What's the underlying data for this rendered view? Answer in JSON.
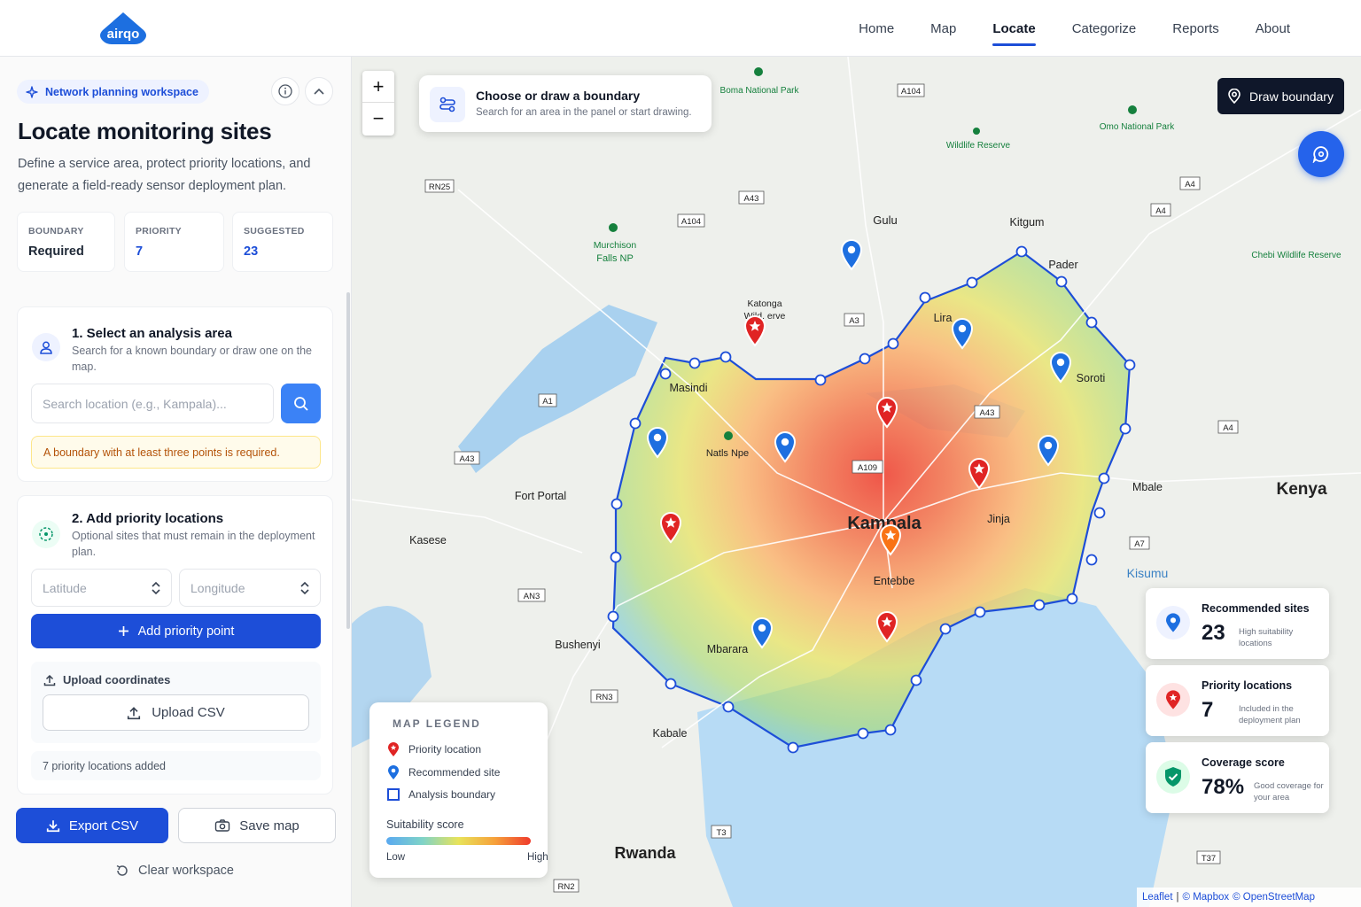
{
  "nav": {
    "brand": "airqo",
    "items": [
      "Home",
      "Map",
      "Locate",
      "Categorize",
      "Reports",
      "About"
    ],
    "active": "Locate"
  },
  "sidebar": {
    "badge": "Network planning workspace",
    "title": "Locate monitoring sites",
    "description": "Define a service area, protect priority locations, and generate a field-ready sensor deployment plan.",
    "stats": [
      {
        "label": "BOUNDARY",
        "value": "Required"
      },
      {
        "label": "PRIORITY",
        "value": "7"
      },
      {
        "label": "SUGGESTED",
        "value": "23"
      }
    ],
    "step1": {
      "title": "1. Select an analysis area",
      "subtitle": "Search for a known boundary or draw one on the map.",
      "search_placeholder": "Search location (e.g., Kampala)...",
      "warning": "A boundary with at least three points is required."
    },
    "step2": {
      "title": "2. Add priority locations",
      "subtitle": "Optional sites that must remain in the deployment plan.",
      "lat_placeholder": "Latitude",
      "lon_placeholder": "Longitude",
      "add_button": "Add priority point",
      "upload_title": "Upload coordinates",
      "upload_button": "Upload CSV",
      "added_text": "7 priority locations added"
    },
    "export_button": "Export CSV",
    "save_button": "Save map",
    "clear_button": "Clear workspace"
  },
  "map": {
    "boundary_card": {
      "title": "Choose or draw a boundary",
      "subtitle": "Search for an area in the panel or start drawing."
    },
    "draw_button": "Draw boundary",
    "labels": {
      "kampala": "Kampala",
      "entebbe": "Entebbe",
      "jinja": "Jinja",
      "masindi": "Masindi",
      "fort_portal": "Fort Portal",
      "kasese": "Kasese",
      "bushenyi": "Bushenyi",
      "mbarara": "Mbarara",
      "kabale": "Kabale",
      "rwanda": "Rwanda",
      "kenya": "Kenya",
      "kisumu": "Kisumu",
      "mbale": "Mbale",
      "soroti": "Soroti",
      "lira": "Lira",
      "gulu": "Gulu",
      "kitgum": "Kitgum",
      "pader": "Pader",
      "katonga": "Katonga",
      "wildlife_reserve_a": "Wild. erve",
      "murchison": "Murchison",
      "falls_np": "Falls NP",
      "boma": "Boma National Park",
      "omo": "Omo National Park",
      "wildlife_reserve": "Wildlife Reserve",
      "chebi": "Chebi Wildlife Reserve",
      "natls": "Natls Npe"
    },
    "roads": [
      "A104",
      "RN25",
      "A43",
      "A104",
      "A3",
      "A4",
      "A4",
      "A1",
      "A43",
      "A109",
      "A43",
      "A4",
      "A7",
      "AN3",
      "RN3",
      "T3",
      "RN2",
      "T37"
    ],
    "legend": {
      "title": "MAP LEGEND",
      "items": [
        "Priority location",
        "Recommended site",
        "Analysis boundary"
      ],
      "score_label": "Suitability score",
      "low": "Low",
      "high": "High",
      "colors": {
        "priority": "#e02424",
        "recommended": "#1d6fe0",
        "boundary": "#1d4ed8"
      }
    },
    "kpis": [
      {
        "title": "Recommended sites",
        "value": "23",
        "sub": "High suitability locations"
      },
      {
        "title": "Priority locations",
        "value": "7",
        "sub": "Included in the deployment plan"
      },
      {
        "title": "Coverage score",
        "value": "78%",
        "sub": "Good coverage for your area"
      }
    ],
    "attribution": {
      "leaflet": "Leaflet",
      "sep1": "|",
      "mapbox": "© Mapbox",
      "osm": "© OpenStreetMap"
    }
  }
}
